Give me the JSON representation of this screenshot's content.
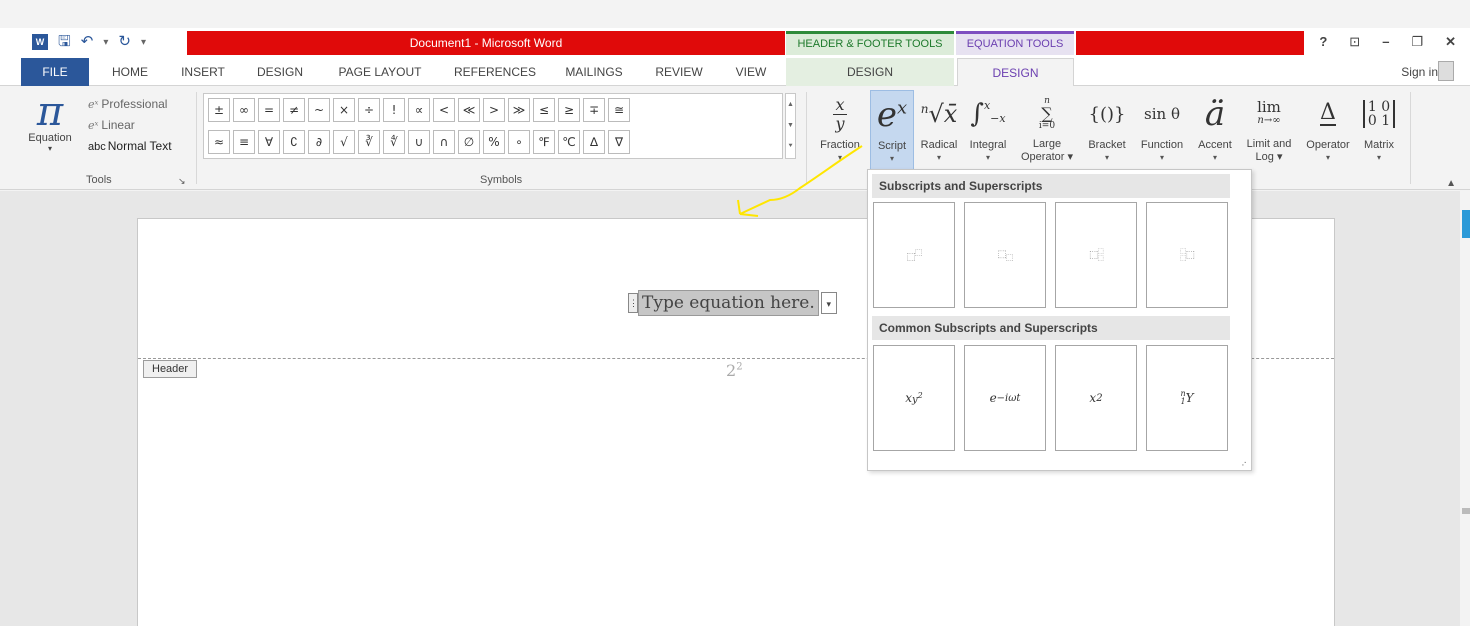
{
  "titlebar": {
    "title": "Document1 - Microsoft Word",
    "qat_undo": "↶",
    "qat_redo": "↻",
    "qat_more": "▾",
    "word_icon": "W",
    "context_header_footer": "HEADER & FOOTER TOOLS",
    "context_equation": "EQUATION TOOLS",
    "help": "?",
    "restore_ribbon": "⊡",
    "minimize": "–",
    "maximize": "❐",
    "close": "✕",
    "accent_color": "#e00a0a"
  },
  "tabs": {
    "file": "FILE",
    "items": [
      "HOME",
      "INSERT",
      "DESIGN",
      "PAGE LAYOUT",
      "REFERENCES",
      "MAILINGS",
      "REVIEW",
      "VIEW"
    ],
    "hf_design": "DESIGN",
    "eq_design": "DESIGN",
    "sign_in": "Sign in"
  },
  "ribbon": {
    "tools": {
      "equation_label": "Equation",
      "equation_glyph": "π",
      "professional": "Professional",
      "linear": "Linear",
      "normal_text": "Normal Text",
      "abc": "abc",
      "group_label": "Tools",
      "launcher": "↘"
    },
    "symbols": {
      "row1": [
        "±",
        "∞",
        "=",
        "≠",
        "~",
        "×",
        "÷",
        "!",
        "∝",
        "<",
        "≪",
        ">",
        "≫",
        "≤",
        "≥",
        "∓",
        "≅"
      ],
      "row2": [
        "≈",
        "≡",
        "∀",
        "∁",
        "∂",
        "√",
        "∛",
        "∜",
        "∪",
        "∩",
        "∅",
        "%",
        "∘",
        "℉",
        "℃",
        "∆",
        "∇"
      ],
      "group_label": "Symbols"
    },
    "structures": [
      {
        "label": "Fraction",
        "glyph": "x/y"
      },
      {
        "label": "Script",
        "glyph": "eˣ"
      },
      {
        "label": "Radical",
        "glyph": "ⁿ√x"
      },
      {
        "label": "Integral",
        "glyph": "∫"
      },
      {
        "label": "Large Operator",
        "glyph": "∑"
      },
      {
        "label": "Bracket",
        "glyph": "{()}"
      },
      {
        "label": "Function",
        "glyph": "sin θ"
      },
      {
        "label": "Accent",
        "glyph": "ä"
      },
      {
        "label": "Limit and Log",
        "glyph": "lim"
      },
      {
        "label": "Operator",
        "glyph": "Δ"
      },
      {
        "label": "Matrix",
        "glyph": "[10 01]"
      }
    ]
  },
  "document": {
    "equation_placeholder": "Type equation here.",
    "header_tag": "Header",
    "footer_base": "2",
    "footer_exp": "2"
  },
  "gallery": {
    "section1_title": "Subscripts and Superscripts",
    "section2_title": "Common Subscripts and Superscripts",
    "common": [
      {
        "base": "x",
        "sub": "y",
        "sub2": "2"
      },
      {
        "base": "e",
        "sup": "−iωt"
      },
      {
        "base": "x",
        "sup": "2"
      },
      {
        "pre_sup": "n",
        "pre_sub": "1",
        "base": "Y"
      }
    ]
  }
}
